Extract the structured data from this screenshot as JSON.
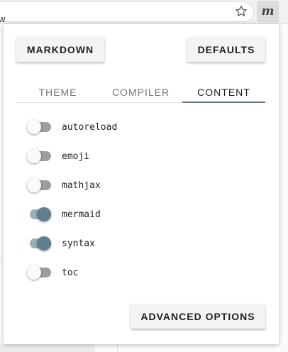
{
  "browser": {
    "star_icon": "star-outline-icon",
    "extension_glyph": "m",
    "page_cut_text": "w"
  },
  "popup": {
    "buttons": {
      "markdown": "MARKDOWN",
      "defaults": "DEFAULTS",
      "advanced": "ADVANCED OPTIONS"
    },
    "tabs": [
      {
        "label": "THEME",
        "active": false
      },
      {
        "label": "COMPILER",
        "active": false
      },
      {
        "label": "CONTENT",
        "active": true
      }
    ],
    "options": [
      {
        "label": "autoreload",
        "enabled": false
      },
      {
        "label": "emoji",
        "enabled": false
      },
      {
        "label": "mathjax",
        "enabled": false
      },
      {
        "label": "mermaid",
        "enabled": true
      },
      {
        "label": "syntax",
        "enabled": true
      },
      {
        "label": "toc",
        "enabled": false
      }
    ]
  },
  "colors": {
    "accent": "#5f7f8e",
    "switch_on_track": "#9ab0bb",
    "switch_off_track": "#9e9e9e"
  }
}
